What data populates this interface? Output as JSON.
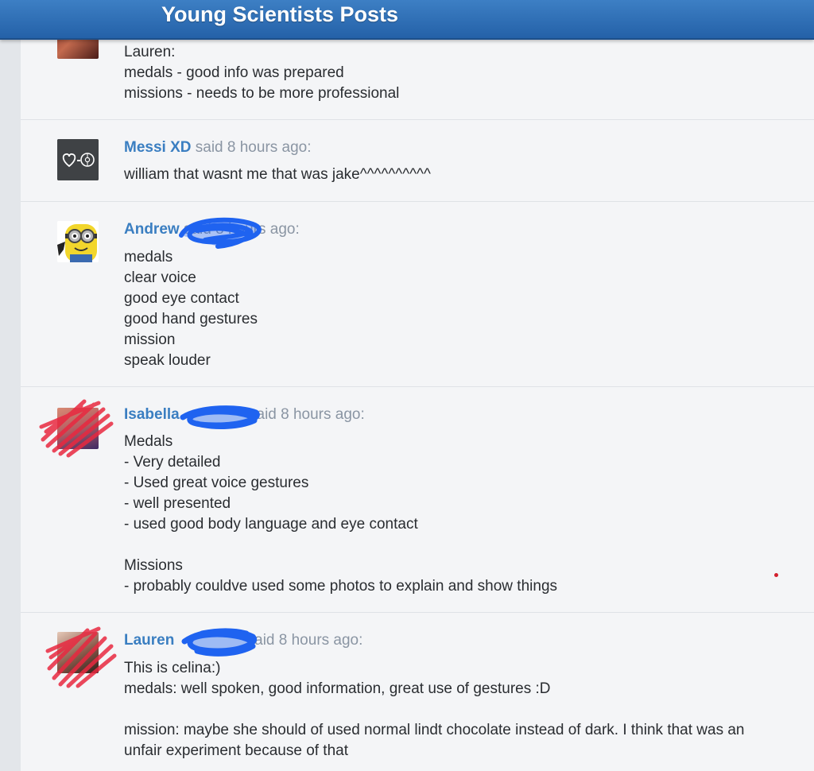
{
  "header": {
    "title": "Young Scientists Posts"
  },
  "posts": [
    {
      "author": "",
      "meta": "",
      "lines": [
        "Lauren:",
        "medals - good info was prepared",
        "missions - needs to be more professional"
      ]
    },
    {
      "author": "Messi XD",
      "meta": " said 8 hours ago:",
      "lines": [
        "william that wasnt me that was jake^^^^^^^^^^"
      ]
    },
    {
      "author": "Andrew",
      "meta": " said 8 hours ago:",
      "lines": [
        "medals",
        "clear voice",
        "good eye contact",
        "good hand gestures",
        "mission",
        "speak louder"
      ]
    },
    {
      "author": "Isabella",
      "meta": " said 8 hours ago:",
      "lines": [
        "Medals",
        "- Very detailed",
        "- Used great voice gestures",
        "- well presented",
        "- used good body language and eye contact",
        "",
        "Missions",
        "- probably couldve used some photos to explain and show things"
      ]
    },
    {
      "author": "Lauren",
      "meta": " said 8 hours ago:",
      "lines": [
        "This is celina:)",
        "medals: well spoken, good information, great use of gestures :D",
        "",
        "mission: maybe she should of used normal lindt chocolate instead of dark. I think that was an",
        "unfair experiment because of that"
      ]
    }
  ],
  "colors": {
    "header": "#2a6bb3",
    "author": "#3a7ec1",
    "meta": "#8a95a3",
    "redaction": "#1f63f0",
    "scribble": "#e8283f"
  }
}
